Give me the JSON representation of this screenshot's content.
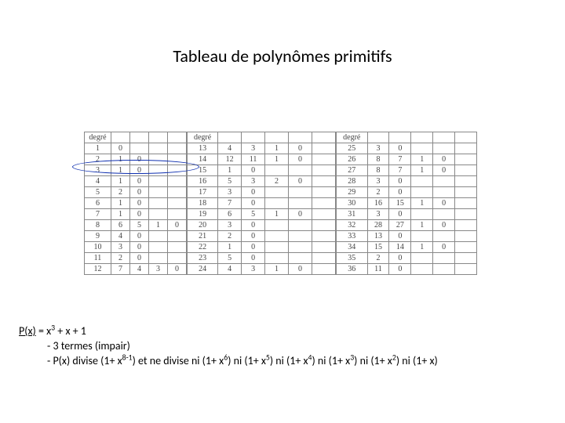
{
  "title": "Tableau de polynômes primitifs",
  "header": "degré",
  "block1": {
    "rows": [
      [
        "1",
        "0",
        "",
        "",
        ""
      ],
      [
        "2",
        "1",
        "0",
        "",
        ""
      ],
      [
        "3",
        "1",
        "0",
        "",
        ""
      ],
      [
        "4",
        "1",
        "0",
        "",
        ""
      ],
      [
        "5",
        "2",
        "0",
        "",
        ""
      ],
      [
        "6",
        "1",
        "0",
        "",
        ""
      ],
      [
        "7",
        "1",
        "0",
        "",
        ""
      ],
      [
        "8",
        "6",
        "5",
        "1",
        "0"
      ],
      [
        "9",
        "4",
        "0",
        "",
        ""
      ],
      [
        "10",
        "3",
        "0",
        "",
        ""
      ],
      [
        "11",
        "2",
        "0",
        "",
        ""
      ],
      [
        "12",
        "7",
        "4",
        "3",
        "0"
      ]
    ]
  },
  "block2": {
    "rows": [
      [
        "13",
        "4",
        "3",
        "1",
        "0",
        ""
      ],
      [
        "14",
        "12",
        "11",
        "1",
        "0",
        ""
      ],
      [
        "15",
        "1",
        "0",
        "",
        "",
        ""
      ],
      [
        "16",
        "5",
        "3",
        "2",
        "0",
        ""
      ],
      [
        "17",
        "3",
        "0",
        "",
        "",
        ""
      ],
      [
        "18",
        "7",
        "0",
        "",
        "",
        ""
      ],
      [
        "19",
        "6",
        "5",
        "1",
        "0",
        ""
      ],
      [
        "20",
        "3",
        "0",
        "",
        "",
        ""
      ],
      [
        "21",
        "2",
        "0",
        "",
        "",
        ""
      ],
      [
        "22",
        "1",
        "0",
        "",
        "",
        ""
      ],
      [
        "23",
        "5",
        "0",
        "",
        "",
        ""
      ],
      [
        "24",
        "4",
        "3",
        "1",
        "0",
        ""
      ]
    ]
  },
  "block3": {
    "rows": [
      [
        "25",
        "3",
        "0",
        "",
        "",
        ""
      ],
      [
        "26",
        "8",
        "7",
        "1",
        "0",
        ""
      ],
      [
        "27",
        "8",
        "7",
        "1",
        "0",
        ""
      ],
      [
        "28",
        "3",
        "0",
        "",
        "",
        ""
      ],
      [
        "29",
        "2",
        "0",
        "",
        "",
        ""
      ],
      [
        "30",
        "16",
        "15",
        "1",
        "0",
        ""
      ],
      [
        "31",
        "3",
        "0",
        "",
        "",
        ""
      ],
      [
        "32",
        "28",
        "27",
        "1",
        "0",
        ""
      ],
      [
        "33",
        "13",
        "0",
        "",
        "",
        ""
      ],
      [
        "34",
        "15",
        "14",
        "1",
        "0",
        ""
      ],
      [
        "35",
        "2",
        "0",
        "",
        "",
        ""
      ],
      [
        "36",
        "11",
        "0",
        "",
        "",
        ""
      ]
    ]
  },
  "notes": {
    "l1_a": "P(x)",
    "l1_b": " = x",
    "l1_sup1": "3",
    "l1_c": " + x + 1",
    "l2": "- 3 termes (impair)",
    "l3_a": "- P(x) divise (1+ x",
    "l3_sup1": "8-1",
    "l3_b": ") et ne divise ni (1+ x",
    "l3_sup2": "6",
    "l3_c": ") ni (1+ x",
    "l3_sup3": "5",
    "l3_d": ") ni (1+ x",
    "l3_sup4": "4",
    "l3_e": ") ni (1+ x",
    "l3_sup5": "3",
    "l3_f": ") ni (1+ x",
    "l3_sup6": "2",
    "l3_g": ") ni (1+ x)"
  }
}
